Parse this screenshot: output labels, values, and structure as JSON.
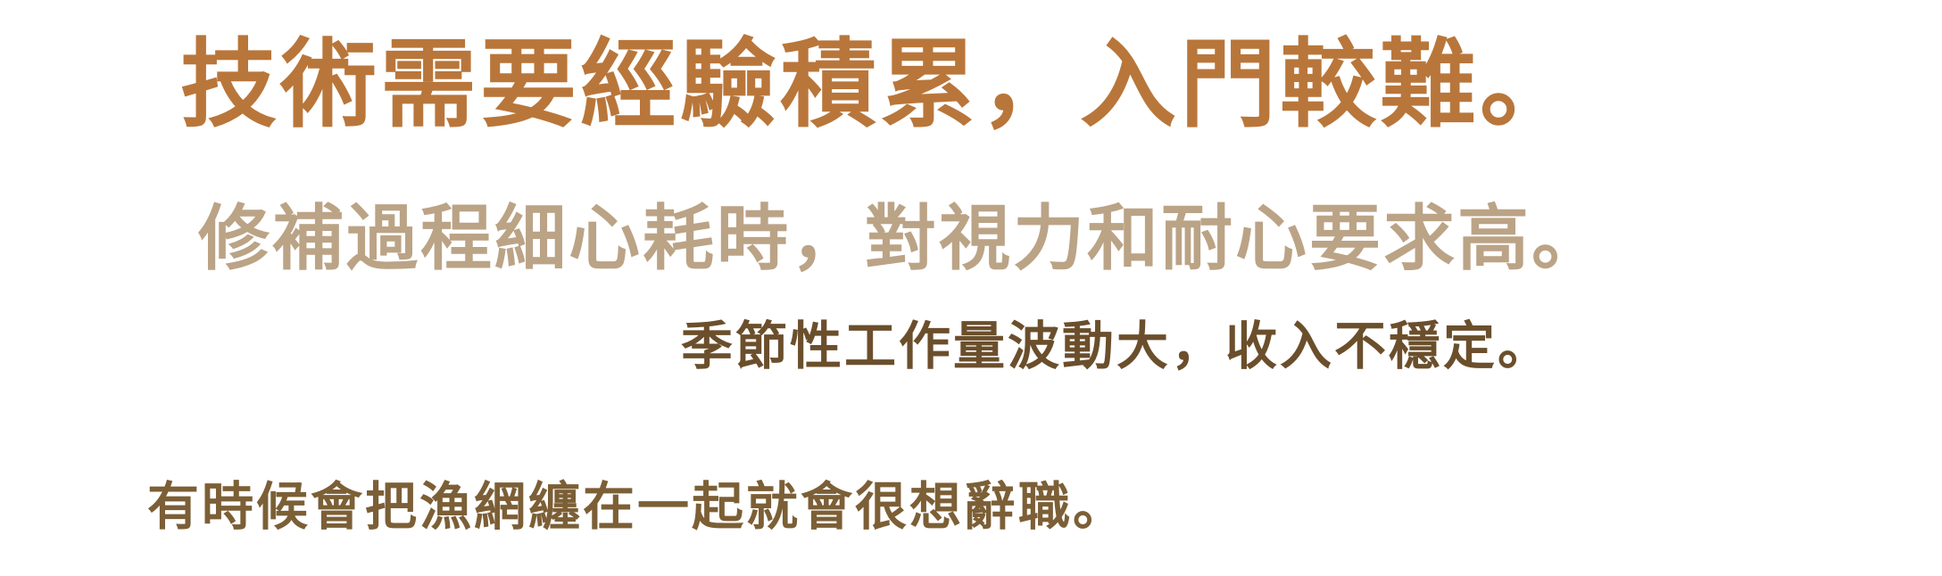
{
  "lines": [
    {
      "text": "技術需要經驗積累，入門較難。",
      "color": "#b9763a"
    },
    {
      "text": "修補過程細心耗時，對視力和耐心要求高。",
      "color": "#bba386"
    },
    {
      "text": "季節性工作量波動大，收入不穩定。",
      "color": "#6b4f2c"
    },
    {
      "text": "有時候會把漁網纏在一起就會很想辭職。",
      "color": "#7c5f36"
    }
  ]
}
